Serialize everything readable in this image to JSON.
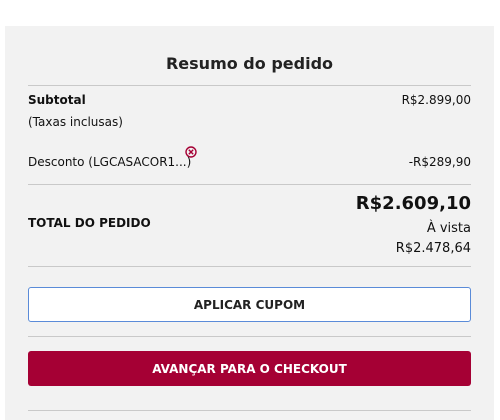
{
  "summary": {
    "title": "Resumo do pedido",
    "subtotal_label": "Subtotal",
    "subtotal_value": "R$2.899,00",
    "tax_note": "(Taxas inclusas)",
    "discount_label": "Desconto (LGCASACOR1...)",
    "discount_value": "-R$289,90",
    "remove_icon": "remove-circle-x-icon",
    "total_label": "TOTAL DO PEDIDO",
    "total_value": "R$2.609,10",
    "cash_label": "À vista",
    "cash_value": "R$2.478,64",
    "coupon_button": "APLICAR CUPOM",
    "checkout_button": "AVANÇAR PARA O CHECKOUT"
  },
  "colors": {
    "accent": "#a50034",
    "coupon_border": "#5a8bd8",
    "panel_bg": "#f2f2f2"
  }
}
